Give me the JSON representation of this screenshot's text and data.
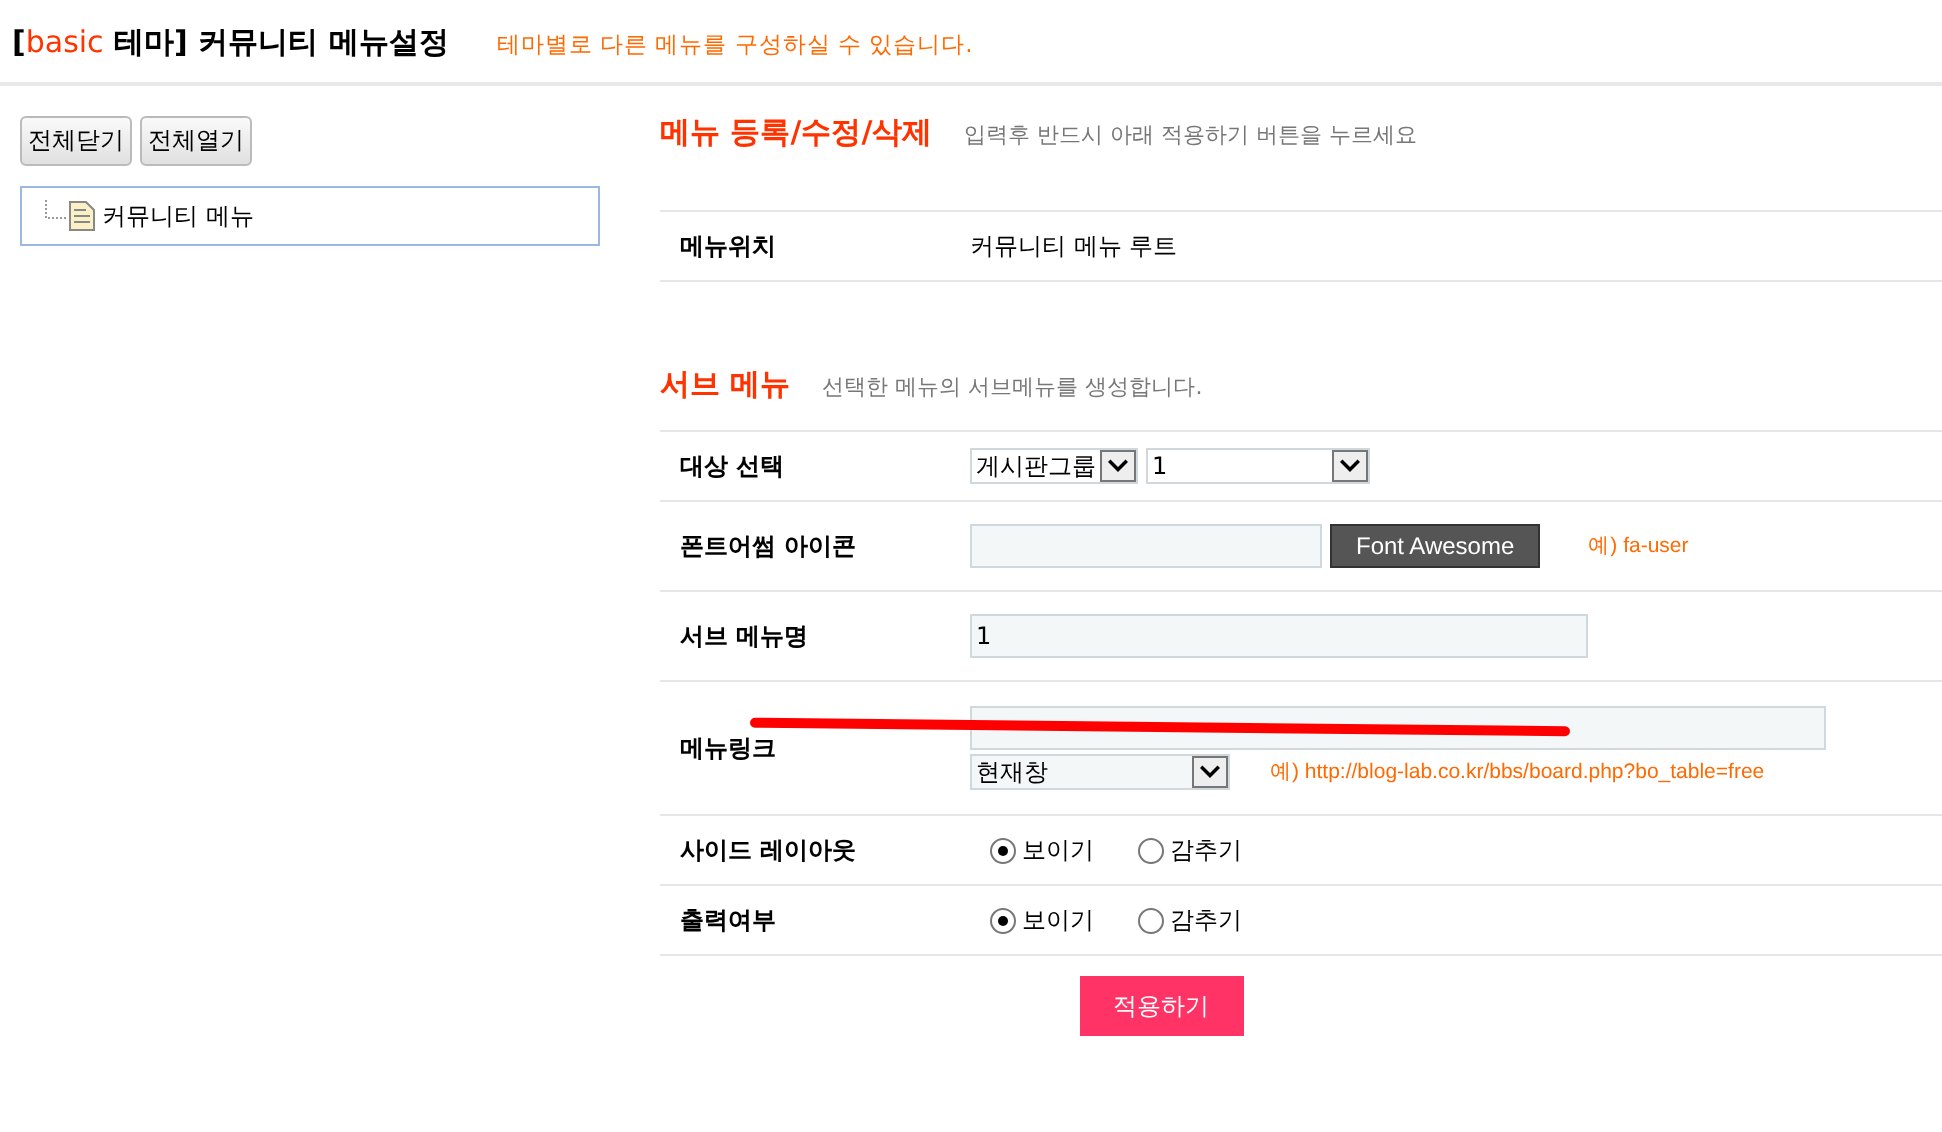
{
  "header": {
    "title_prefix": "[",
    "title_theme": "basic",
    "title_rest": " 테마] 커뮤니티 메뉴설정",
    "note": "테마별로 다른 메뉴를 구성하실 수 있습니다."
  },
  "tree_buttons": [
    "전체닫기",
    "전체열기"
  ],
  "tree": [
    {
      "label": "커뮤니티 메뉴",
      "selected": false
    }
  ],
  "edit_section": {
    "title": "메뉴 등록/수정/삭제",
    "hint": "입력후 반드시 아래 적용하기 버튼을 누르세요",
    "rows": [
      {
        "label": "메뉴위치",
        "value": "커뮤니티 메뉴 루트"
      }
    ]
  },
  "sub_section": {
    "title": "서브 메뉴",
    "hint": "선택한 메뉴의 서브메뉴를 생성합니다.",
    "rows": [
      {
        "kind": "selects",
        "label": "대상 선택",
        "selects": [
          {
            "value": "게시판그룹"
          },
          {
            "value": "1"
          }
        ]
      },
      {
        "kind": "icon",
        "label": "폰트어썸 아이콘",
        "button": "Font Awesome",
        "example": "예) fa-user"
      },
      {
        "kind": "text",
        "label": "서브 메뉴명",
        "value": "1"
      },
      {
        "kind": "link",
        "label": "메뉴링크",
        "redacted": true,
        "target": "현재창",
        "example": "예) http://blog-lab.co.kr/bbs/board.php?bo_table=free"
      },
      {
        "kind": "radios",
        "label": "사이드 레이아웃",
        "options": [
          {
            "label": "보이기",
            "selected": true
          },
          {
            "label": "감추기",
            "selected": false
          }
        ]
      },
      {
        "kind": "radios",
        "label": "출력여부",
        "options": [
          {
            "label": "보이기",
            "selected": true
          },
          {
            "label": "감추기",
            "selected": false
          }
        ]
      }
    ]
  },
  "submit": "적용하기"
}
